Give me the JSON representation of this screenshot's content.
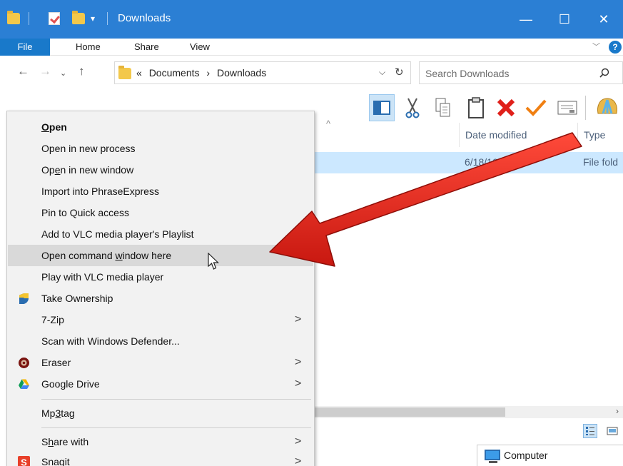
{
  "window": {
    "title": "Downloads",
    "accent": "#2b7fd4"
  },
  "ribbon": {
    "tabs": [
      "File",
      "Home",
      "Share",
      "View"
    ],
    "help": "?"
  },
  "address": {
    "prefix": "«",
    "crumbs": [
      "Documents",
      "Downloads"
    ],
    "separator": "›"
  },
  "search": {
    "placeholder": "Search Downloads"
  },
  "file_list": {
    "columns": [
      "Date modified",
      "Type"
    ],
    "row": {
      "date": "6/18/16",
      "type": "File fold"
    }
  },
  "status": {
    "computer_label": "Computer"
  },
  "context_menu": {
    "items": [
      {
        "pre": "",
        "u": "O",
        "post": "pen",
        "icon": "",
        "submenu": false
      },
      {
        "pre": "Open in new process",
        "u": "",
        "post": "",
        "icon": "",
        "submenu": false
      },
      {
        "pre": "Op",
        "u": "e",
        "post": "n in new window",
        "icon": "",
        "submenu": false
      },
      {
        "pre": "Import into PhraseExpress",
        "u": "",
        "post": "",
        "icon": "",
        "submenu": false
      },
      {
        "pre": "Pin to Quick access",
        "u": "",
        "post": "",
        "icon": "",
        "submenu": false
      },
      {
        "pre": "Add to VLC media player's Playlist",
        "u": "",
        "post": "",
        "icon": "",
        "submenu": false
      },
      {
        "pre": "Open command ",
        "u": "w",
        "post": "indow here",
        "icon": "",
        "submenu": false
      },
      {
        "pre": "Play with VLC media player",
        "u": "",
        "post": "",
        "icon": "",
        "submenu": false
      },
      {
        "pre": "Take Ownership",
        "u": "",
        "post": "",
        "icon": "shield-icon",
        "submenu": false
      },
      {
        "pre": "7-Zip",
        "u": "",
        "post": "",
        "icon": "",
        "submenu": true
      },
      {
        "pre": "Scan with Windows Defender...",
        "u": "",
        "post": "",
        "icon": "",
        "submenu": false
      },
      {
        "pre": "Eraser",
        "u": "",
        "post": "",
        "icon": "eraser-icon",
        "submenu": true
      },
      {
        "pre": "Google Drive",
        "u": "",
        "post": "",
        "icon": "google-drive-icon",
        "submenu": true
      },
      {
        "pre": "Mp",
        "u": "3",
        "post": "tag",
        "icon": "",
        "submenu": false
      },
      {
        "pre": "S",
        "u": "h",
        "post": "are with",
        "icon": "",
        "submenu": true
      },
      {
        "pre": "Snagit",
        "u": "",
        "post": "",
        "icon": "snagit-icon",
        "submenu": true
      }
    ],
    "highlighted_index": 6,
    "highlight_color": "#d9d9d9"
  },
  "annotation": {
    "arrow_color": "#e8251c"
  }
}
